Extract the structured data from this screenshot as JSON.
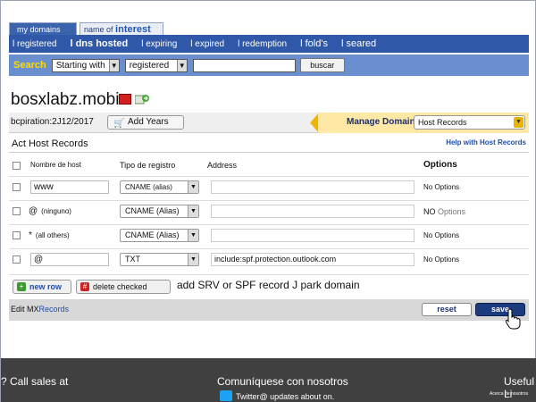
{
  "tabs": [
    {
      "label": "my domains"
    },
    {
      "label": "name of",
      "emph": "interest"
    }
  ],
  "nav": [
    "l registered",
    "l dns hosted",
    "l expiring",
    "l expired",
    "l redemption",
    "l fold's",
    "l seared"
  ],
  "search": {
    "label": "Search",
    "mode": "Starting with",
    "scope": "registered",
    "query": "",
    "button": "buscar"
  },
  "domain": {
    "name": "bosxlabz.mobi",
    "expiration": "bcpiration:2J12/2017",
    "add_years": "Add Years",
    "manage_label": "Manage Domain:",
    "manage_value": "Host Records"
  },
  "records": {
    "title": "Act Host Records",
    "help": "Help with Host Records",
    "columns": {
      "host": "Nombre de host",
      "type": "Tipo de registro",
      "address": "Address",
      "options": "Options"
    },
    "rows": [
      {
        "host": "www",
        "host_note": "",
        "type": "CNAME (alias)",
        "address": "",
        "options": "No Options"
      },
      {
        "host": "@",
        "host_note": "(ninguno)",
        "type": "CNAME (Alias)",
        "address": "",
        "options_a": "NO",
        "options_b": " Options"
      },
      {
        "host": "*",
        "host_note": "(all others)",
        "type": "CNAME (Alias)",
        "address": "",
        "options": "No Options"
      },
      {
        "host": "@",
        "host_note": "",
        "type": "TXT",
        "address": "include:spf.protection.outlook.com",
        "options": "No Options"
      }
    ]
  },
  "actions": {
    "new_row": "new row",
    "delete_checked": "delete checked",
    "note": "add SRV or SPF record J park domain"
  },
  "bottom": {
    "edit_prefix": "Edit MX",
    "edit_link": "Records",
    "reset": "reset",
    "save": "save"
  },
  "footer": {
    "call": "? Call sales at",
    "contact": "Comuníquese con nosotros",
    "useful": "Useful Li",
    "twitter": "Twitter@ updates about on.",
    "small": "Acerca de nosotros"
  },
  "colors": {
    "nav": "#2f59a8",
    "searchbar": "#6a8fcf",
    "search_label": "#ffdd00",
    "manage": "#fde8a6",
    "save": "#1c3b7e",
    "footer": "#404040"
  }
}
